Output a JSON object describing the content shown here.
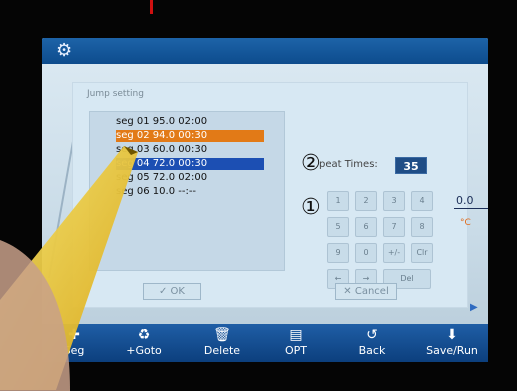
{
  "window": {
    "title_icon": "gear-icon"
  },
  "dialog": {
    "title": "Jump setting",
    "repeat_label": "peat Times:",
    "repeat_value": "35",
    "ok_label": "✓ OK",
    "cancel_label": "✕ Cancel"
  },
  "segments": [
    {
      "label": "seg 01  95.0 02:00",
      "state": "normal"
    },
    {
      "label": "seg 02  94.0 00:30",
      "state": "orange"
    },
    {
      "label": "seg 03  60.0 00:30",
      "state": "normal"
    },
    {
      "label": "seg 04  72.0 00:30",
      "state": "blue"
    },
    {
      "label": "seg 05  72.0 02:00",
      "state": "normal"
    },
    {
      "label": "seg 06  10.0 --:--",
      "state": "normal"
    }
  ],
  "markers": {
    "circle_2": "②",
    "circle_1": "①"
  },
  "keypad": {
    "keys": [
      "1",
      "2",
      "3",
      "4",
      "5",
      "6",
      "7",
      "8",
      "9",
      "0",
      "+/-",
      "Clr",
      "←",
      "→",
      "Del"
    ]
  },
  "right_panel": {
    "value": "0.0",
    "orange_text": "°C"
  },
  "toolbar": {
    "items": [
      {
        "label": "Seg",
        "icon": "add-segment-icon"
      },
      {
        "label": "+Goto",
        "icon": "goto-icon"
      },
      {
        "label": "Delete",
        "icon": "trash-icon"
      },
      {
        "label": "OPT",
        "icon": "option-icon"
      },
      {
        "label": "Back",
        "icon": "back-icon"
      },
      {
        "label": "Save/Run",
        "icon": "save-run-icon"
      }
    ]
  },
  "colors": {
    "selected_orange": "#e27a17",
    "selected_blue": "#1c4fb3",
    "titlebar": "#1d63a8",
    "repeat_box": "#1f4d86"
  }
}
